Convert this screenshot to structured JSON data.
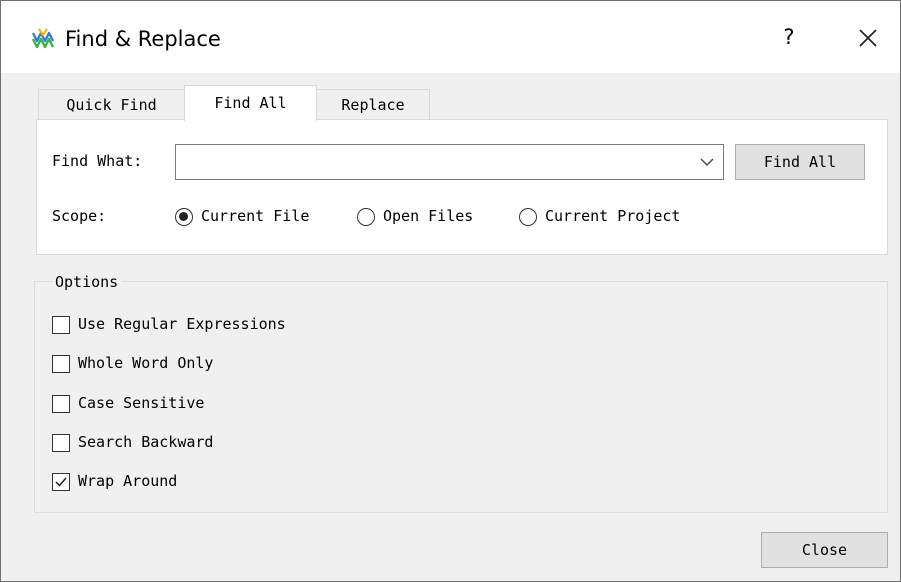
{
  "window": {
    "title": "Find & Replace",
    "help_label": "?",
    "close_icon": "close-icon",
    "app_icon": "gowin-logo-icon"
  },
  "tabs": [
    {
      "label": "Quick Find",
      "active": false
    },
    {
      "label": "Find All",
      "active": true
    },
    {
      "label": "Replace",
      "active": false
    }
  ],
  "find_all": {
    "find_what_label": "Find What:",
    "find_what_value": "",
    "find_button_label": "Find All",
    "scope_label": "Scope:",
    "scope_options": [
      {
        "label": "Current File",
        "selected": true
      },
      {
        "label": "Open Files",
        "selected": false
      },
      {
        "label": "Current Project",
        "selected": false
      }
    ]
  },
  "options": {
    "legend": "Options",
    "items": [
      {
        "label": "Use Regular Expressions",
        "checked": false
      },
      {
        "label": "Whole Word Only",
        "checked": false
      },
      {
        "label": "Case Sensitive",
        "checked": false
      },
      {
        "label": "Search Backward",
        "checked": false
      },
      {
        "label": "Wrap Around",
        "checked": true
      }
    ]
  },
  "footer": {
    "close_label": "Close"
  },
  "colors": {
    "dialog_bg": "#f0f0f0",
    "button_bg": "#e1e1e1",
    "logo_blue": "#2e7fd6",
    "logo_green": "#3bb34a"
  }
}
